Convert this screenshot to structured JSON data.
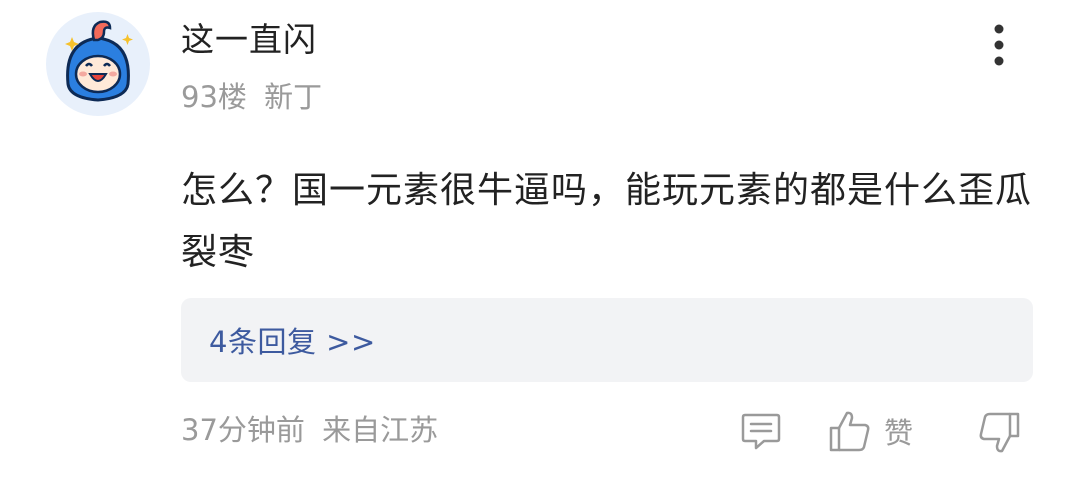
{
  "post": {
    "username": "这一直闪",
    "floor": "93楼",
    "user_tag": "新丁",
    "content": "怎么？国一元素很牛逼吗，能玩元素的都是什么歪瓜裂枣",
    "replies_link": "4条回复 >>",
    "time": "37分钟前",
    "location": "来自江苏",
    "like_label": "赞"
  },
  "icons": {
    "avatar": "cartoon-avatar-icon",
    "more": "more-vertical-icon",
    "comment": "comment-icon",
    "like": "thumbs-up-icon",
    "dislike": "thumbs-down-icon"
  },
  "colors": {
    "reply_link": "#3d5a9f",
    "secondary_text": "#9a9a9a",
    "primary_text": "#222222",
    "reply_box_bg": "#f2f3f5"
  }
}
